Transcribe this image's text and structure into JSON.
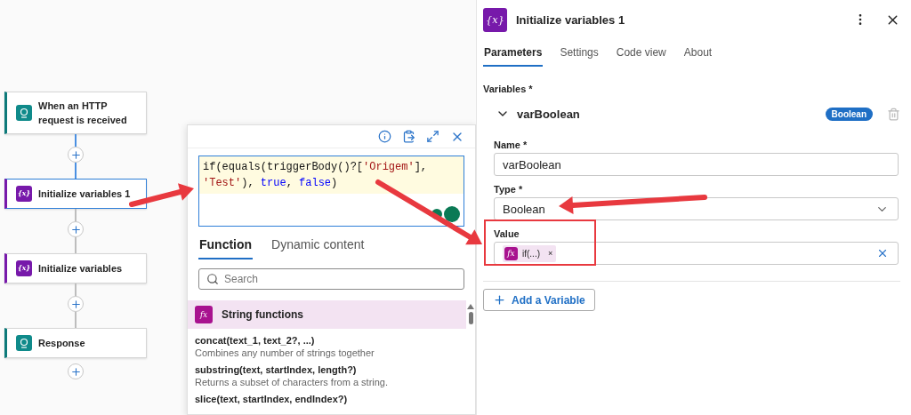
{
  "flow": {
    "nodes": [
      {
        "label": "When an HTTP request is received",
        "kind": "http",
        "selected": false
      },
      {
        "label": "Initialize variables 1",
        "kind": "variable",
        "icon_text": "{x}",
        "selected": true
      },
      {
        "label": "Initialize variables",
        "kind": "variable",
        "icon_text": "{x}",
        "selected": false
      },
      {
        "label": "Response",
        "kind": "http",
        "selected": false
      }
    ]
  },
  "expression_editor": {
    "code_lines": [
      [
        {
          "text": "if(equals(triggerBody()?[",
          "kind": "plain"
        },
        {
          "text": "'Origem'",
          "kind": "string"
        },
        {
          "text": "],",
          "kind": "plain"
        }
      ],
      [
        {
          "text": "'Test'",
          "kind": "string"
        },
        {
          "text": "), ",
          "kind": "plain"
        },
        {
          "text": "true",
          "kind": "keyword"
        },
        {
          "text": ", ",
          "kind": "plain"
        },
        {
          "text": "false",
          "kind": "keyword"
        },
        {
          "text": ")",
          "kind": "plain"
        }
      ]
    ],
    "tabs": [
      {
        "label": "Function",
        "selected": true
      },
      {
        "label": "Dynamic content",
        "selected": false
      }
    ],
    "search": {
      "placeholder": "Search"
    },
    "category": {
      "title": "String functions",
      "icon_text": "fx"
    },
    "functions": [
      {
        "signature": "concat(text_1, text_2?, ...)",
        "description": "Combines any number of strings together"
      },
      {
        "signature": "substring(text, startIndex, length?)",
        "description": "Returns a subset of characters from a string."
      },
      {
        "signature": "slice(text, startIndex, endIndex?)"
      }
    ]
  },
  "panel": {
    "title": "Initialize variables 1",
    "icon_text": "{x}",
    "tabs": [
      {
        "label": "Parameters",
        "selected": true
      },
      {
        "label": "Settings",
        "selected": false
      },
      {
        "label": "Code view",
        "selected": false
      },
      {
        "label": "About",
        "selected": false
      }
    ],
    "variables_label": "Variables *",
    "variable": {
      "name": "varBoolean",
      "type_badge": "Boolean",
      "expanded": true
    },
    "fields": [
      {
        "label": "Name *",
        "kind": "text",
        "value": "varBoolean"
      },
      {
        "label": "Type *",
        "kind": "select",
        "value": "Boolean"
      },
      {
        "label": "Value",
        "kind": "token",
        "token": "if(...)",
        "token_icon": "fx",
        "token_close": "×"
      }
    ],
    "add_button": "Add a Variable"
  }
}
